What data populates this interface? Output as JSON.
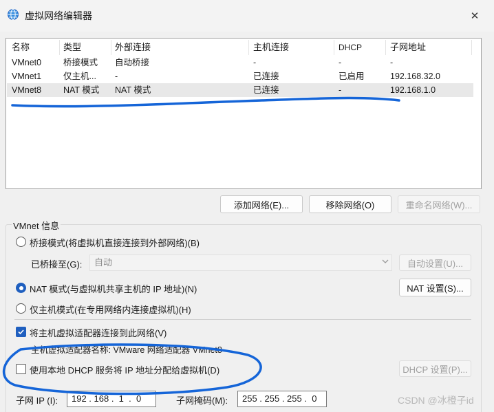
{
  "window": {
    "title": "虚拟网络编辑器",
    "close_glyph": "✕"
  },
  "table": {
    "headers": [
      "名称",
      "类型",
      "外部连接",
      "主机连接",
      "DHCP",
      "子网地址"
    ],
    "rows": [
      [
        "VMnet0",
        "桥接模式",
        "自动桥接",
        "-",
        "-",
        "-"
      ],
      [
        "VMnet1",
        "仅主机...",
        "-",
        "已连接",
        "已启用",
        "192.168.32.0"
      ],
      [
        "VMnet8",
        "NAT 模式",
        "NAT 模式",
        "已连接",
        "-",
        "192.168.1.0"
      ]
    ],
    "selected_row": 2
  },
  "buttons": {
    "add_network": "添加网络(E)...",
    "remove_network": "移除网络(O)",
    "rename_network": "重命名网络(W)..."
  },
  "vmnet_info": {
    "title": "VMnet 信息",
    "bridged_label": "桥接模式(将虚拟机直接连接到外部网络)(B)",
    "bridged_to_label": "已桥接至(G):",
    "bridged_to_value": "自动",
    "auto_settings": "自动设置(U)...",
    "nat_label": "NAT 模式(与虚拟机共享主机的 IP 地址)(N)",
    "nat_settings": "NAT 设置(S)...",
    "host_only_label": "仅主机模式(在专用网络内连接虚拟机)(H)",
    "mode_selected": "nat",
    "connect_adapter_label": "将主机虚拟适配器连接到此网络(V)",
    "connect_adapter_checked": true,
    "adapter_name_label": "主机虚拟适配器名称: VMware 网络适配器 VMnet8",
    "dhcp_label": "使用本地 DHCP 服务将 IP 地址分配给虚拟机(D)",
    "dhcp_checked": false,
    "dhcp_settings": "DHCP 设置(P)...",
    "subnet_ip_label": "子网 IP (I):",
    "subnet_ip_value": "192 . 168 .  1  .  0",
    "subnet_mask_label": "子网掩码(M):",
    "subnet_mask_value": "255 . 255 . 255 .  0"
  },
  "watermark": "CSDN @冰橙子id",
  "colors": {
    "accent": "#1f5fbf",
    "annotation": "#1565d8"
  }
}
